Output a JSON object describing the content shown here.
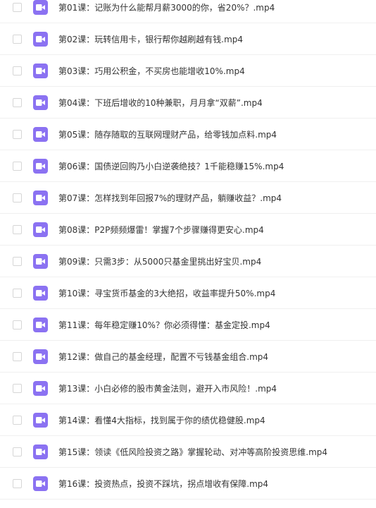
{
  "files": [
    {
      "name": "第01课：记账为什么能帮月薪3000的你，省20%？.mp4",
      "icon": "video-file-icon"
    },
    {
      "name": "第02课：玩转信用卡，银行帮你越刷越有钱.mp4",
      "icon": "video-file-icon"
    },
    {
      "name": "第03课：巧用公积金，不买房也能增收10%.mp4",
      "icon": "video-file-icon"
    },
    {
      "name": "第04课：下班后增收的10种兼职，月月拿“双薪”.mp4",
      "icon": "video-file-icon"
    },
    {
      "name": "第05课：随存随取的互联网理财产品，给零钱加点料.mp4",
      "icon": "video-file-icon"
    },
    {
      "name": "第06课：国债逆回购乃小白逆袭绝技？1千能稳赚15%.mp4",
      "icon": "video-file-icon"
    },
    {
      "name": "第07课：怎样找到年回报7%的理财产品，躺赚收益？.mp4",
      "icon": "video-file-icon"
    },
    {
      "name": "第08课：P2P频频爆雷！掌握7个步骤赚得更安心.mp4",
      "icon": "video-file-icon"
    },
    {
      "name": "第09课：只需3步：从5000只基金里挑出好宝贝.mp4",
      "icon": "video-file-icon"
    },
    {
      "name": "第10课：寻宝货币基金的3大绝招，收益率提升50%.mp4",
      "icon": "video-file-icon"
    },
    {
      "name": "第11课：每年稳定赚10%？你必须得懂：基金定投.mp4",
      "icon": "video-file-icon"
    },
    {
      "name": "第12课：做自己的基金经理，配置不亏钱基金组合.mp4",
      "icon": "video-file-icon"
    },
    {
      "name": "第13课：小白必修的股市黄金法则，避开入市风险！.mp4",
      "icon": "video-file-icon"
    },
    {
      "name": "第14课：看懂4大指标，找到属于你的绩优稳健股.mp4",
      "icon": "video-file-icon"
    },
    {
      "name": "第15课：领读《低风险投资之路》掌握轮动、对冲等高阶投资思维.mp4",
      "icon": "video-file-icon"
    },
    {
      "name": "第16课：投资热点，投资不踩坑，拐点增收有保障.mp4",
      "icon": "video-file-icon"
    }
  ],
  "colors": {
    "icon": "#8b72f2",
    "text": "#333333",
    "divider": "#f0f0f0",
    "checkbox_border": "#d6d6d6"
  }
}
